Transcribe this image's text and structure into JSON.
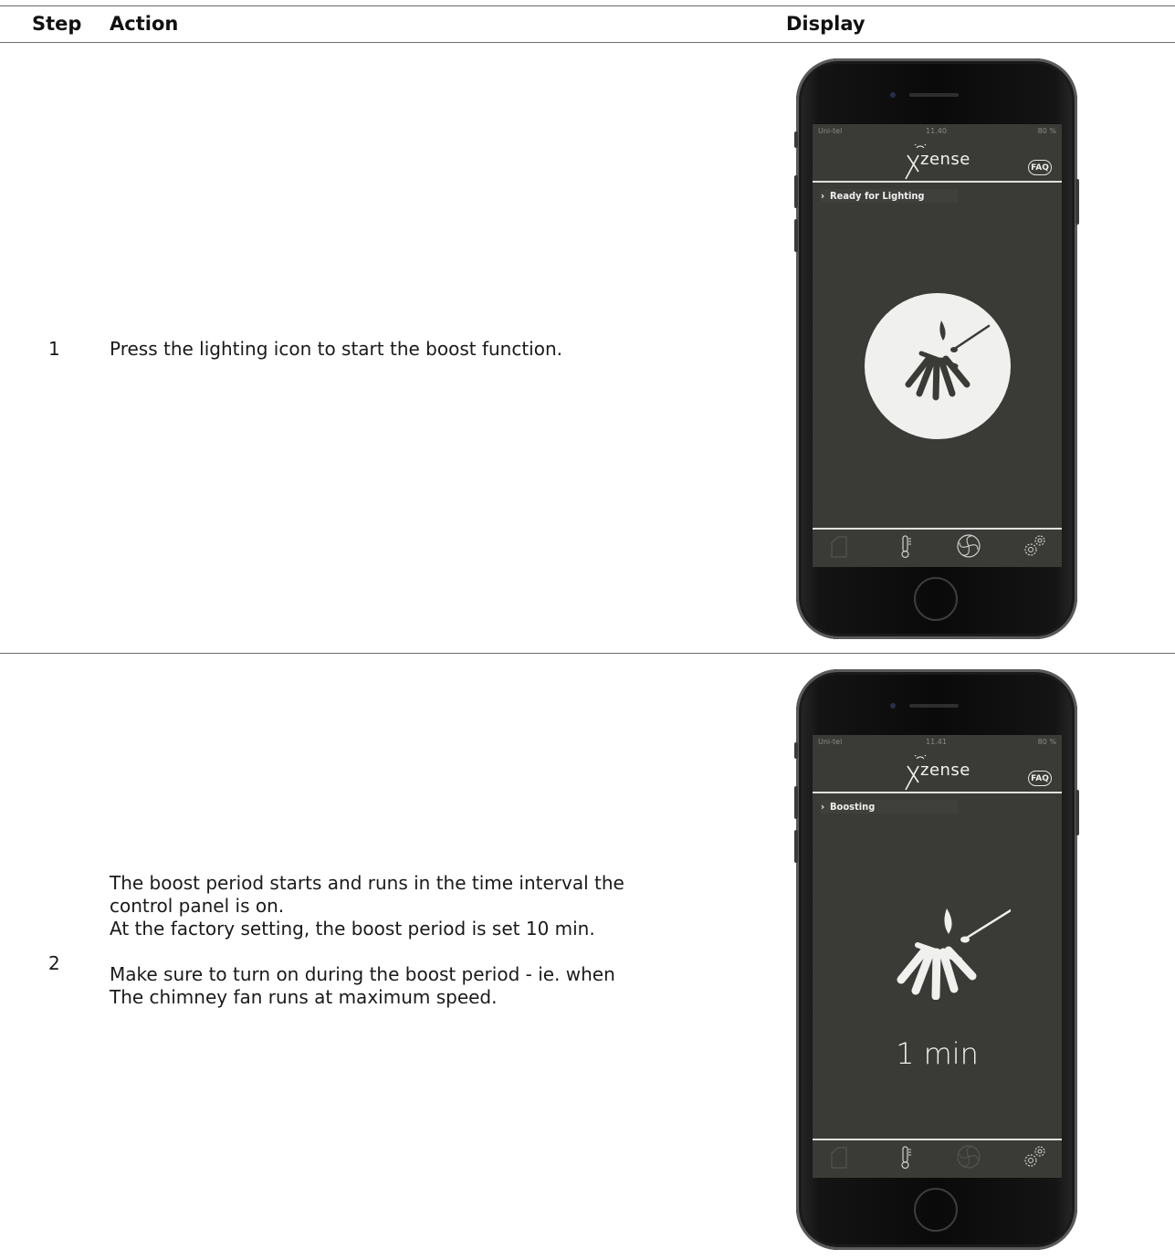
{
  "header": {
    "step": "Step",
    "action": "Action",
    "display": "Display"
  },
  "rows": [
    {
      "step": "1",
      "action_lines": [
        "Press the lighting icon to start the boost function."
      ],
      "phone": {
        "status_carrier": "Uni-tel",
        "status_time": "11.40",
        "status_battery": "80 %",
        "logo_text": "zense",
        "faq_label": "FAQ",
        "status_message": "Ready for Lighting"
      }
    },
    {
      "step": "2",
      "action_lines_a": [
        "The boost period starts and runs in the time interval the",
        "control panel is on.",
        "At the factory setting, the boost period is set 10 min."
      ],
      "action_lines_b": [
        "Make sure to turn on during the boost period - ie. when",
        "The chimney fan runs at maximum speed."
      ],
      "phone": {
        "status_carrier": "Uni-tel",
        "status_time": "11.41",
        "status_battery": "80 %",
        "logo_text": "zense",
        "faq_label": "FAQ",
        "status_message": "Boosting",
        "timer": "1 min"
      }
    }
  ],
  "tab_icons": [
    "home-icon",
    "thermometer-icon",
    "fan-icon",
    "settings-icon"
  ],
  "colors": {
    "screen_bg": "#3a3a36",
    "accent_white": "#f0f0ee"
  }
}
